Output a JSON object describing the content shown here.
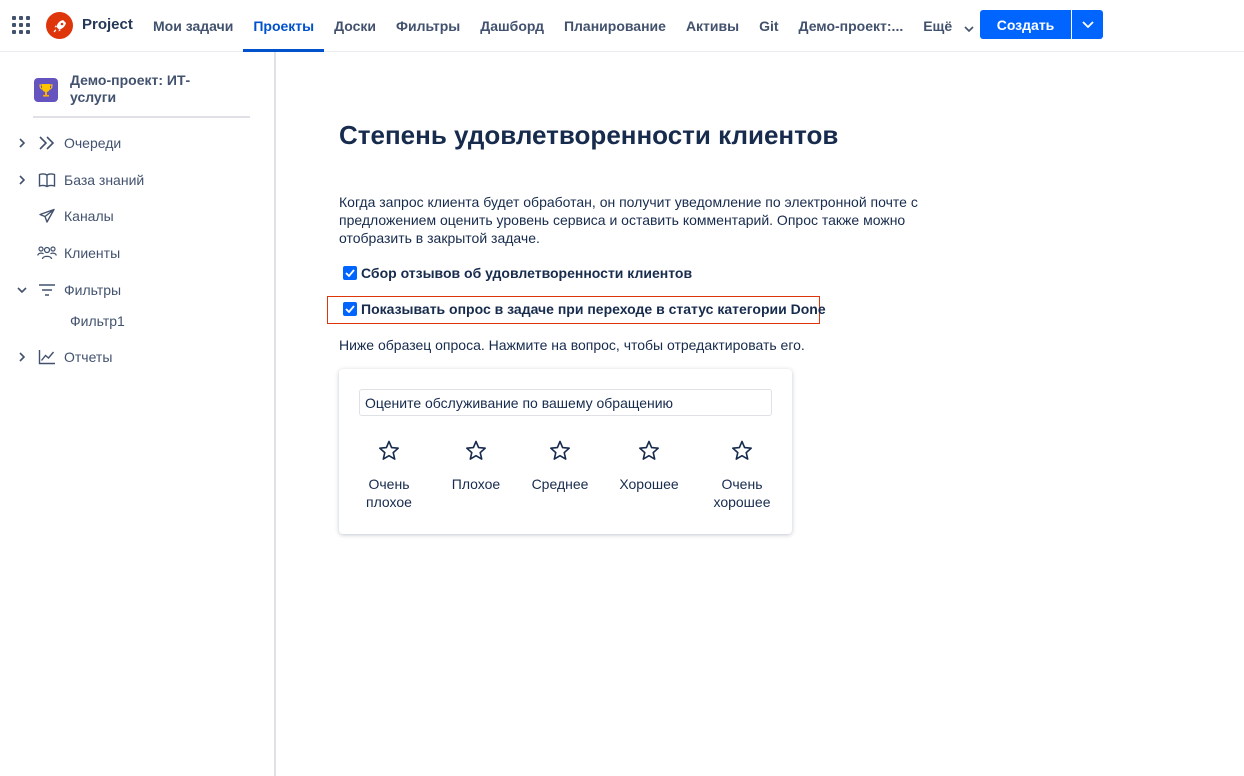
{
  "header": {
    "brand": "Project",
    "nav": [
      {
        "label": "Мои задачи",
        "active": false
      },
      {
        "label": "Проекты",
        "active": true
      },
      {
        "label": "Доски",
        "active": false
      },
      {
        "label": "Фильтры",
        "active": false
      },
      {
        "label": "Дашборд",
        "active": false
      },
      {
        "label": "Планирование",
        "active": false
      },
      {
        "label": "Активы",
        "active": false
      },
      {
        "label": "Git",
        "active": false
      },
      {
        "label": "Демо-проект:...",
        "active": false
      },
      {
        "label": "Ещё",
        "active": false
      }
    ],
    "create_label": "Создать"
  },
  "sidebar": {
    "project_name": "Демо-проект: ИТ-услуги",
    "items": [
      {
        "label": "Очереди",
        "icon": "chevrons-right-icon",
        "expander": "collapsed"
      },
      {
        "label": "База знаний",
        "icon": "book-icon",
        "expander": "collapsed"
      },
      {
        "label": "Каналы",
        "icon": "send-icon",
        "expander": "none"
      },
      {
        "label": "Клиенты",
        "icon": "people-icon",
        "expander": "none"
      },
      {
        "label": "Фильтры",
        "icon": "filter-icon",
        "expander": "expanded"
      },
      {
        "label": "Отчеты",
        "icon": "chart-icon",
        "expander": "collapsed"
      }
    ],
    "sub_items": [
      {
        "label": "Фильтр1"
      }
    ]
  },
  "main": {
    "title": "Степень удовлетворенности клиентов",
    "description": "Когда запрос клиента будет обработан, он получит уведомление по электронной почте с предложением оценить уровень сервиса и оставить комментарий. Опрос также можно отобразить в закрытой задаче.",
    "checkboxes": [
      {
        "label": "Сбор отзывов об удовлетворенности клиентов",
        "checked": true
      },
      {
        "label": "Показывать опрос в задаче при переходе в статус категории Done",
        "checked": true
      }
    ],
    "hint": "Ниже образец опроса. Нажмите на вопрос, чтобы отредактировать его.",
    "survey": {
      "question": "Оцените обслуживание по вашему обращению",
      "ratings": [
        {
          "line1": "Очень",
          "line2": "плохое"
        },
        {
          "line1": "Плохое",
          "line2": ""
        },
        {
          "line1": "Среднее",
          "line2": ""
        },
        {
          "line1": "Хорошее",
          "line2": ""
        },
        {
          "line1": "Очень",
          "line2": "хорошее"
        }
      ]
    }
  },
  "colors": {
    "accent": "#0052cc",
    "button": "#0065ff",
    "highlight": "#de350b",
    "logo": "#de350b"
  }
}
